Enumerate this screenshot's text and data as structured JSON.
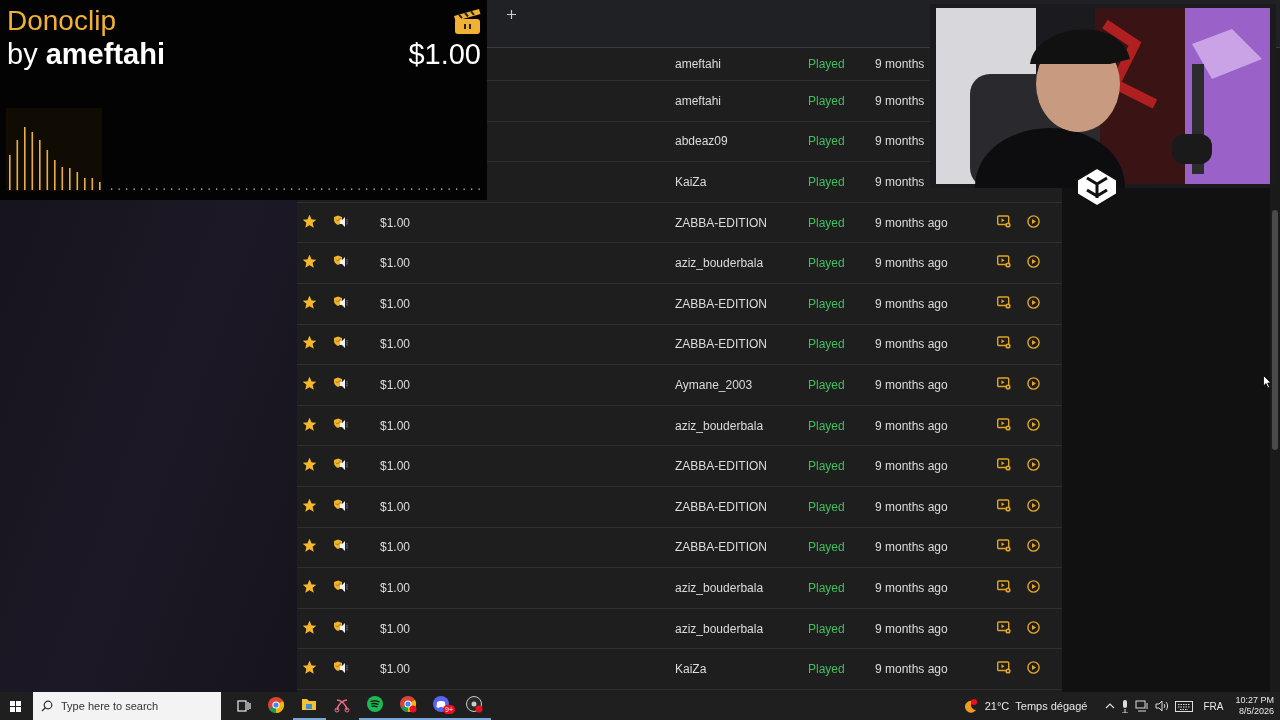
{
  "alert": {
    "brand": "Donoclip",
    "byline": "by **ameftahi**",
    "amount": "$1.00"
  },
  "donations": [
    {
      "donor": "ameftahi",
      "status": "Played",
      "time": "9 months"
    },
    {
      "donor": "ameftahi",
      "status": "Played",
      "time": "9 months"
    },
    {
      "donor": "abdeaz09",
      "status": "Played",
      "time": "9 months"
    },
    {
      "donor": "KaiZa",
      "status": "Played",
      "time": "9 months"
    },
    {
      "favorite": true,
      "amount": "$1.00",
      "donor": "ZABBA-EDITION",
      "status": "Played",
      "time": "9 months ago"
    },
    {
      "favorite": true,
      "amount": "$1.00",
      "donor": "aziz_bouderbala",
      "status": "Played",
      "time": "9 months ago"
    },
    {
      "favorite": true,
      "amount": "$1.00",
      "donor": "ZABBA-EDITION",
      "status": "Played",
      "time": "9 months ago"
    },
    {
      "favorite": true,
      "amount": "$1.00",
      "donor": "ZABBA-EDITION",
      "status": "Played",
      "time": "9 months ago"
    },
    {
      "favorite": true,
      "amount": "$1.00",
      "donor": "Aymane_2003",
      "status": "Played",
      "time": "9 months ago"
    },
    {
      "favorite": true,
      "amount": "$1.00",
      "donor": "aziz_bouderbala",
      "status": "Played",
      "time": "9 months ago"
    },
    {
      "favorite": true,
      "amount": "$1.00",
      "donor": "ZABBA-EDITION",
      "status": "Played",
      "time": "9 months ago"
    },
    {
      "favorite": true,
      "amount": "$1.00",
      "donor": "ZABBA-EDITION",
      "status": "Played",
      "time": "9 months ago"
    },
    {
      "favorite": true,
      "amount": "$1.00",
      "donor": "ZABBA-EDITION",
      "status": "Played",
      "time": "9 months ago"
    },
    {
      "favorite": true,
      "amount": "$1.00",
      "donor": "aziz_bouderbala",
      "status": "Played",
      "time": "9 months ago"
    },
    {
      "favorite": true,
      "amount": "$1.00",
      "donor": "aziz_bouderbala",
      "status": "Played",
      "time": "9 months ago"
    },
    {
      "favorite": true,
      "amount": "$1.00",
      "donor": "KaiZa",
      "status": "Played",
      "time": "9 months ago"
    }
  ],
  "taskbar": {
    "search_placeholder": "Type here to search",
    "apps": [
      {
        "kind": "chrome",
        "running": false
      },
      {
        "kind": "files",
        "running": true
      },
      {
        "kind": "snip",
        "running": false
      },
      {
        "kind": "spotify",
        "running": true
      },
      {
        "kind": "chrome",
        "running": true,
        "alert": true
      },
      {
        "kind": "discord",
        "running": true,
        "badge": "9+"
      },
      {
        "kind": "recorder",
        "running": true,
        "alert": true
      }
    ],
    "weather": {
      "temp": "21°C",
      "condition": "Temps dégagé"
    },
    "language": "FRA",
    "time": "10:27 PM",
    "date": "8/5/2026"
  }
}
